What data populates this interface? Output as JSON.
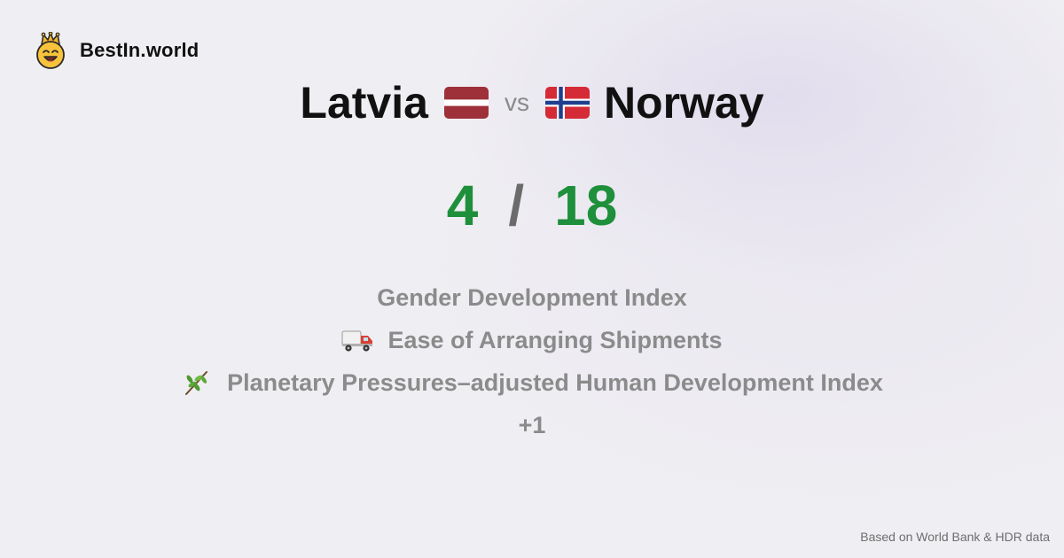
{
  "brand": {
    "name": "BestIn.world",
    "logo_icon": "crowned-smiley-icon"
  },
  "comparison": {
    "left_country": "Latvia",
    "left_flag": "latvia-flag-icon",
    "vs_label": "vs",
    "right_country": "Norway",
    "right_flag": "norway-flag-icon"
  },
  "score": {
    "left": "4",
    "separator": "/",
    "right": "18",
    "color": "#1e8f3a"
  },
  "metrics": [
    {
      "label": "Gender Development Index",
      "icon": ""
    },
    {
      "label": "Ease of Arranging Shipments",
      "icon": "delivery-truck-icon"
    },
    {
      "label": "Planetary Pressures–adjusted Human Development Index",
      "icon": "herb-icon"
    }
  ],
  "more_label": "+1",
  "footer": {
    "source_note": "Based on World Bank & HDR data"
  },
  "colors": {
    "title": "#111111",
    "muted": "#8b8b8b",
    "latvia_red": "#9e3039",
    "norway_red": "#d52b37",
    "norway_blue": "#1f3f8f"
  }
}
